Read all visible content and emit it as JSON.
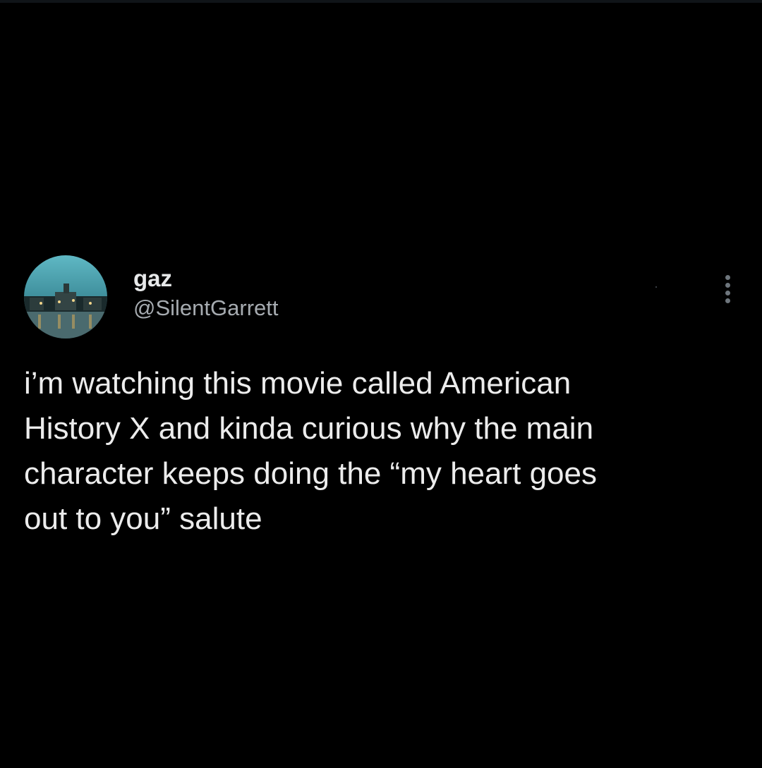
{
  "tweet": {
    "author": {
      "display_name": "gaz",
      "handle": "@SilentGarrett",
      "avatar_icon": "avatar-photo-icon"
    },
    "text": "i’m watching this movie called American\nHistory X and kinda curious why the main\ncharacter keeps doing the “my heart goes\nout to you” salute",
    "more_icon": "more-options-icon"
  },
  "colors": {
    "background": "#000000",
    "text": "#e7e9ea",
    "secondary": "#a6abb0"
  }
}
